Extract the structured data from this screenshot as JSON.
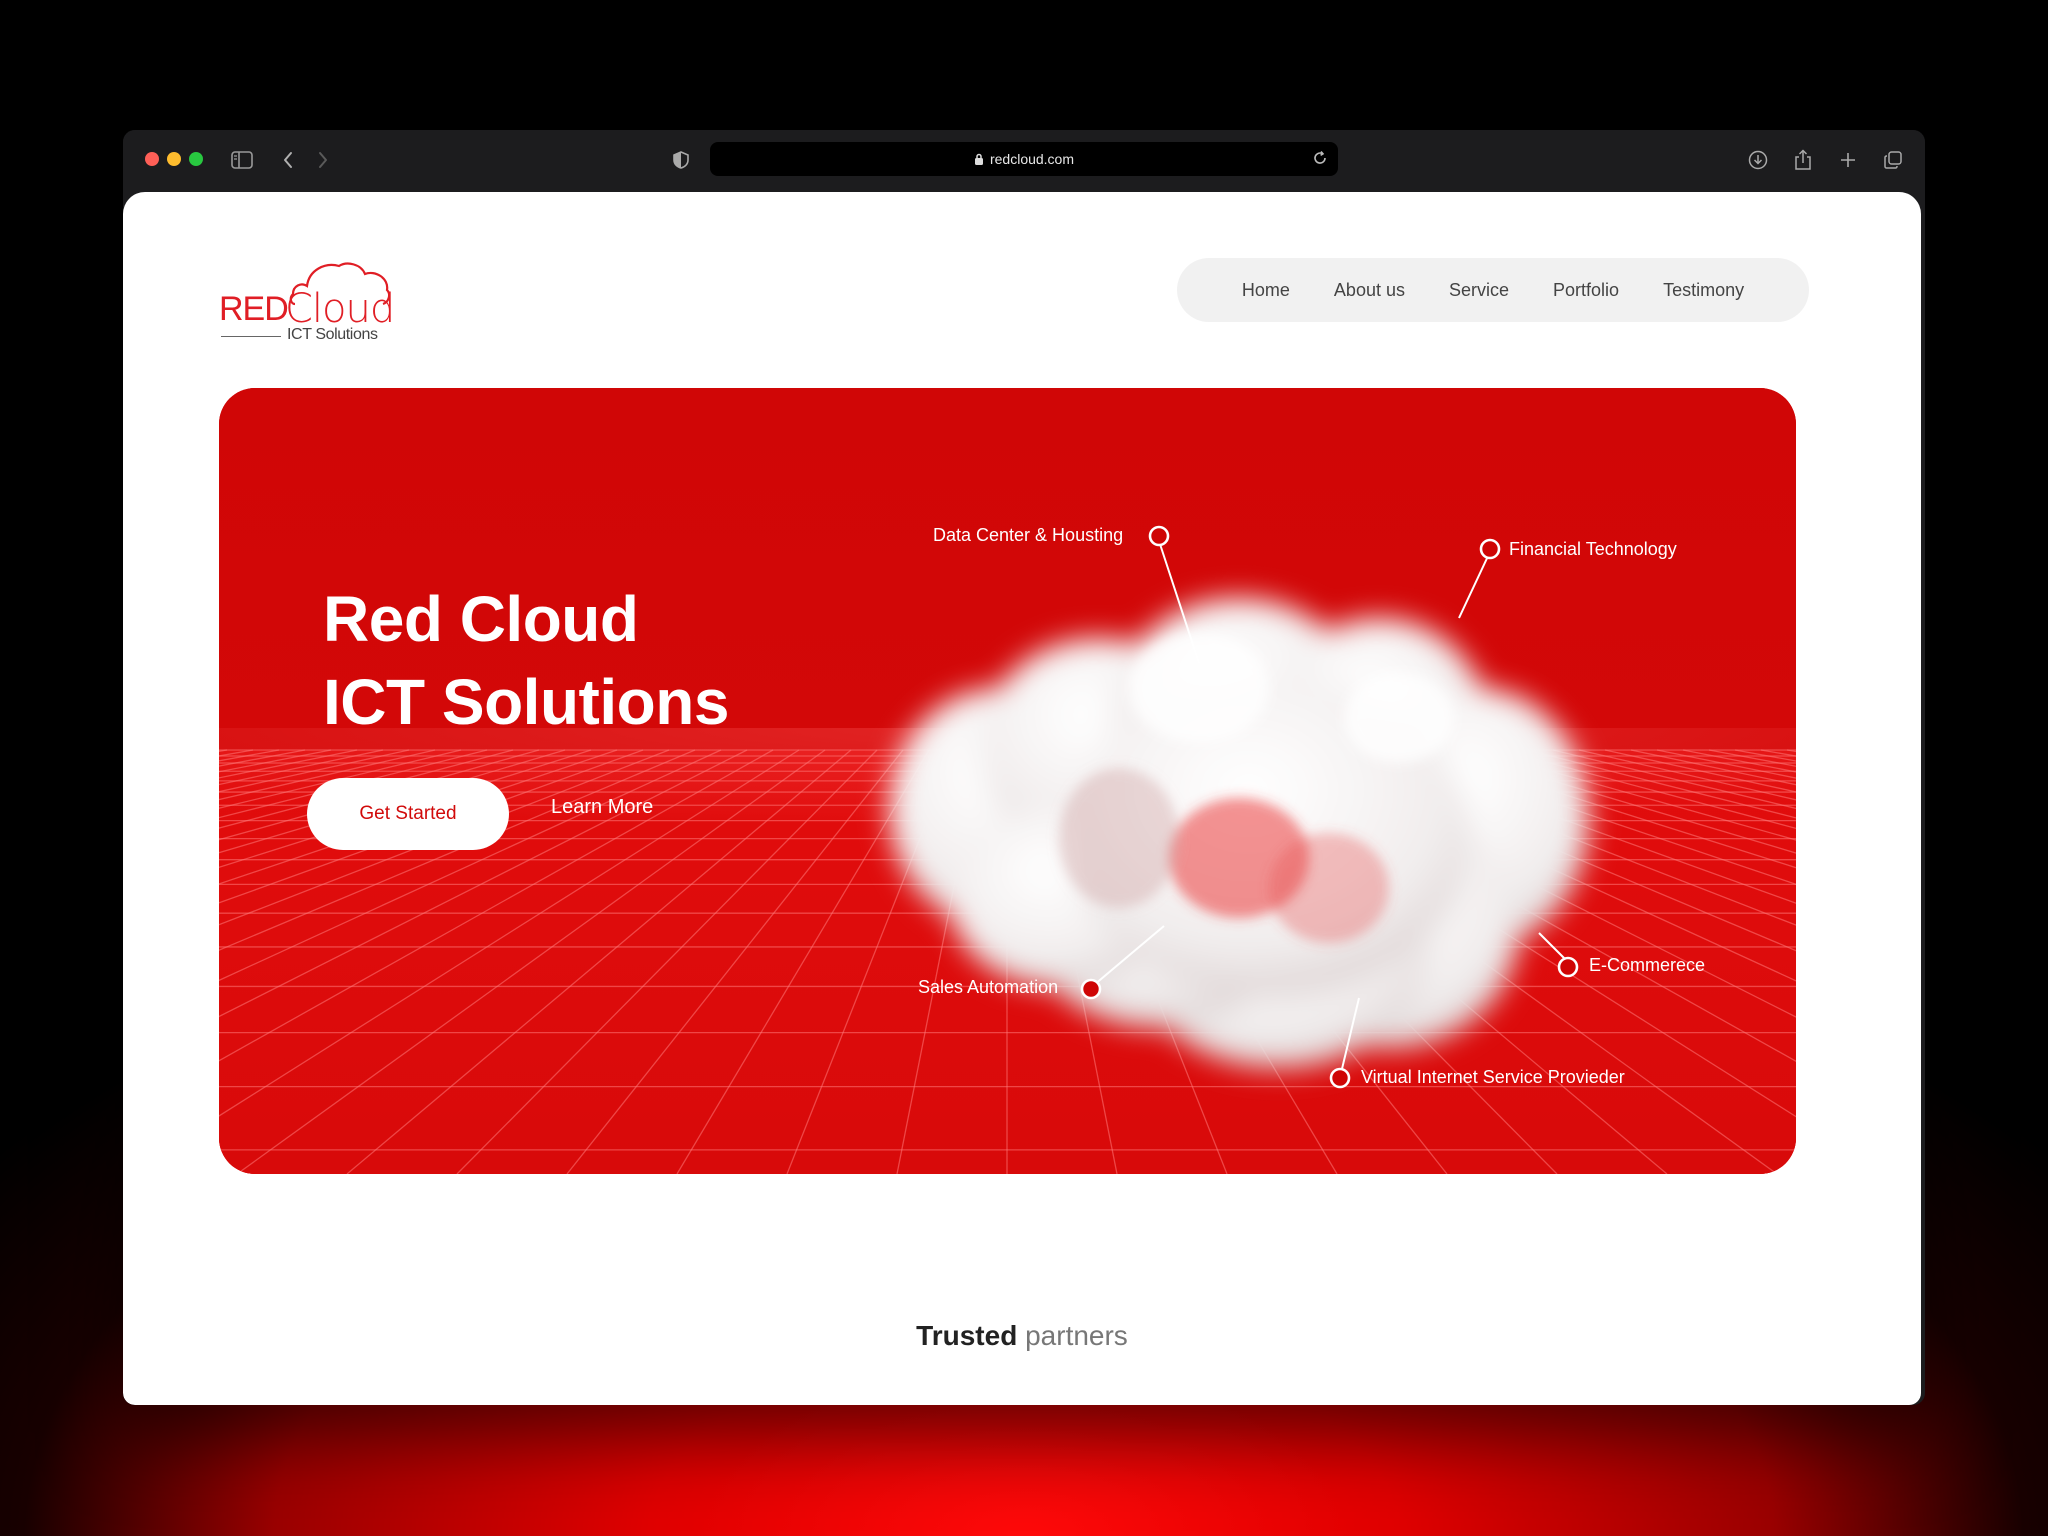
{
  "browser": {
    "url": "redcloud.com"
  },
  "brand": {
    "logo_word1": "RED",
    "logo_word2": "Cloud",
    "logo_sub": "ICT Solutions"
  },
  "nav": {
    "items": [
      {
        "label": "Home"
      },
      {
        "label": "About us"
      },
      {
        "label": "Service"
      },
      {
        "label": "Portfolio"
      },
      {
        "label": "Testimony"
      }
    ]
  },
  "hero": {
    "title_line1": "Red Cloud",
    "title_line2": "ICT Solutions",
    "primary_button": "Get Started",
    "secondary_button": "Learn More",
    "services": [
      {
        "label": "Data Center & Housting"
      },
      {
        "label": "Financial Technology"
      },
      {
        "label": "Sales Automation"
      },
      {
        "label": "E-Commerece"
      },
      {
        "label": "Virtual Internet Service Provieder"
      }
    ]
  },
  "partners": {
    "bold": "Trusted",
    "light": "partners"
  },
  "colors": {
    "accent": "#cf0505",
    "brand_red": "#e01e25"
  }
}
